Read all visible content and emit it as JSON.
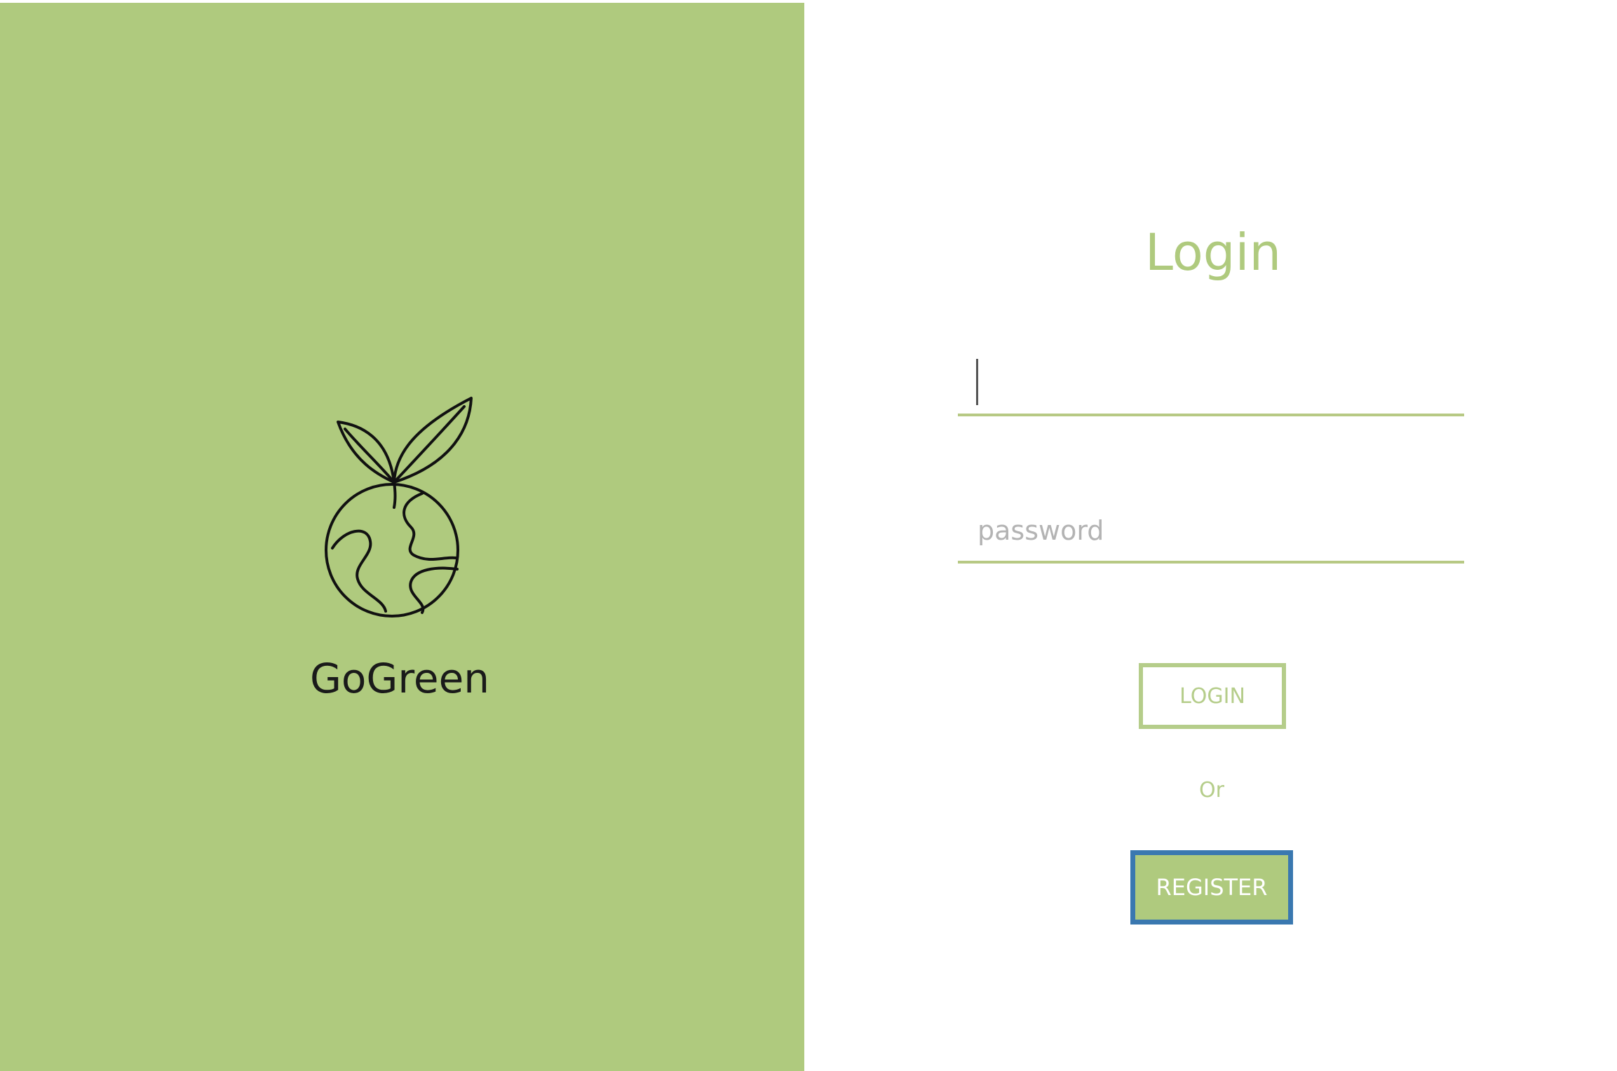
{
  "brand": {
    "name": "GoGreen",
    "logo_icon": "sprout-globe-icon",
    "panel_color": "#afca7e"
  },
  "login_form": {
    "title": "Login",
    "username_value": "",
    "password_placeholder": "password",
    "login_label": "LOGIN",
    "or_label": "Or",
    "register_label": "REGISTER",
    "accent_color": "#afca7e",
    "focus_color": "#3a78b0"
  }
}
